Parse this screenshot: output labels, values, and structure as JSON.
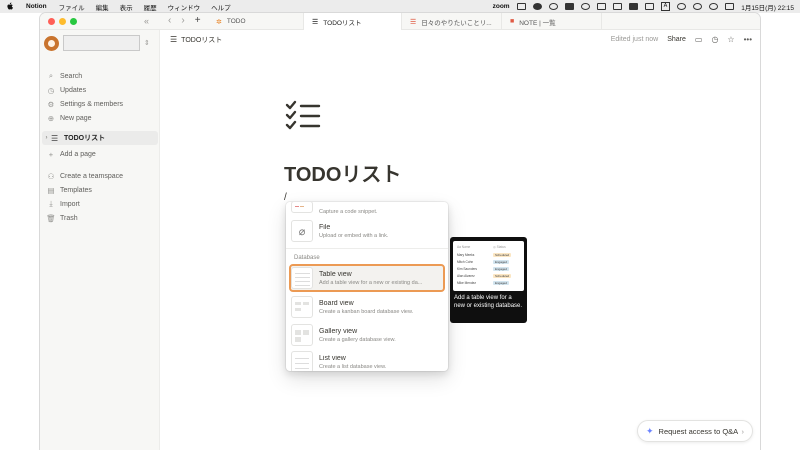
{
  "menubar": {
    "app": "Notion",
    "items": [
      "ファイル",
      "編集",
      "表示",
      "履歴",
      "ウィンドウ",
      "ヘルプ"
    ],
    "zoom_label": "zoom",
    "input_label": "A",
    "datetime": "1月15日(月) 22:15"
  },
  "window": {
    "collapse_icon": "«",
    "tabs": [
      {
        "label": "TODO",
        "icon": "orange-sparkle-icon"
      },
      {
        "label": "TODOリスト",
        "icon": "checklist-icon"
      },
      {
        "label": "日々のやりたいことリ...",
        "icon": "checklist-red-icon"
      },
      {
        "label": "NOTE | 一覧",
        "icon": "red-book-icon"
      }
    ]
  },
  "sidebar": {
    "items": [
      {
        "label": "Search",
        "icon": "search-icon"
      },
      {
        "label": "Updates",
        "icon": "clock-icon"
      },
      {
        "label": "Settings & members",
        "icon": "gear-icon"
      },
      {
        "label": "New page",
        "icon": "plus-circle-icon"
      }
    ],
    "page": {
      "label": "TODOリスト",
      "icon": "checklist-icon"
    },
    "add_page": "Add a page",
    "bottom": [
      {
        "label": "Create a teamspace",
        "icon": "people-icon"
      },
      {
        "label": "Templates",
        "icon": "template-icon"
      },
      {
        "label": "Import",
        "icon": "import-icon"
      },
      {
        "label": "Trash",
        "icon": "trash-icon"
      }
    ]
  },
  "pagebar": {
    "breadcrumb": "TODOリスト",
    "edited": "Edited just now",
    "share": "Share"
  },
  "page": {
    "title": "TODOリスト",
    "cursor_text": "/"
  },
  "menu": {
    "code_desc": "Capture a code snippet.",
    "file": {
      "label": "File",
      "desc": "Upload or embed with a link."
    },
    "section": "Database",
    "items": [
      {
        "label": "Table view",
        "desc": "Add a table view for a new or existing da..."
      },
      {
        "label": "Board view",
        "desc": "Create a kanban board database view."
      },
      {
        "label": "Gallery view",
        "desc": "Create a gallery database view."
      },
      {
        "label": "List view",
        "desc": "Create a list database view."
      }
    ]
  },
  "preview": {
    "text": "Add a table view for a new or existing database.",
    "rows": [
      {
        "name": "Mary Meeks",
        "tag": "Scheduled",
        "color": "#fbe6c3"
      },
      {
        "name": "Mitch Cohn",
        "tag": "Engaged",
        "color": "#d3e5ef"
      },
      {
        "name": "Kim Saunders",
        "tag": "Engaged",
        "color": "#d3e5ef"
      },
      {
        "name": "Alan Alvarez",
        "tag": "Scheduled",
        "color": "#fbe6c3"
      },
      {
        "name": "Mike Mendez",
        "tag": "Engaged",
        "color": "#d3e5ef"
      }
    ]
  },
  "qa": {
    "label": "Request access to Q&A"
  },
  "colors": {
    "accent_outline": "#ec9a54",
    "sidebar_bg": "#f7f7f5"
  }
}
